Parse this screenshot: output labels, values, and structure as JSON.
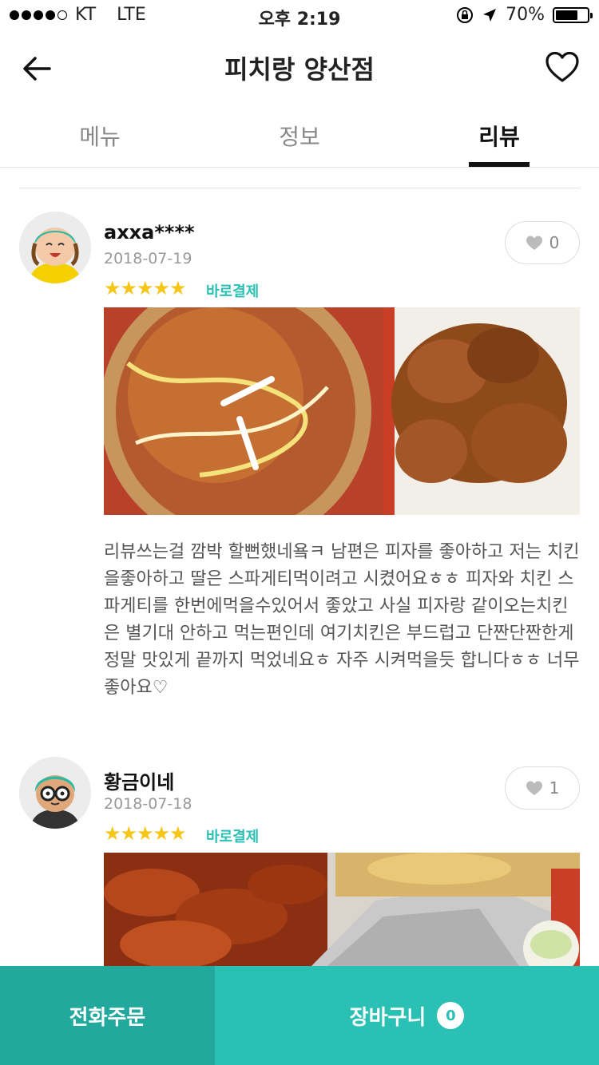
{
  "status_bar": {
    "carrier": "KT",
    "network": "LTE",
    "time": "오후 2:19",
    "battery": "70%",
    "battery_level": 0.7
  },
  "nav": {
    "title": "피치랑 양산점",
    "back_icon": "arrow-left-icon",
    "favorite_icon": "heart-outline-icon"
  },
  "tabs": [
    {
      "label": "메뉴"
    },
    {
      "label": "정보"
    },
    {
      "label": "리뷰",
      "active": true
    }
  ],
  "reviews": [
    {
      "username": "axxa****",
      "date": "2018-07-19",
      "stars": "★★★★★",
      "rating": 5,
      "pay_tag": "바로결제",
      "likes": "0",
      "text": "리뷰쓰는걸 깜박 할뻔했네욬ㅋ 남편은 피자를 좋아하고 저는 치킨을좋아하고 딸은 스파게티먹이려고 시켰어요ㅎㅎ 피자와 치킨 스파게티를 한번에먹을수있어서 좋았고 사실 피자랑 같이오는치킨은 별기대 안하고 먹는편인데 여기치킨은 부드럽고 단짠단짠한게 정말 맛있게 끝까지 먹었네요ㅎ 자주 시켜먹을듯 합니다ㅎㅎ 너무좋아요♡"
    },
    {
      "username": "황금이네",
      "date": "2018-07-18",
      "stars": "★★★★★",
      "rating": 5,
      "pay_tag": "바로결제",
      "likes": "1"
    }
  ],
  "bottom": {
    "phone_order": "전화주문",
    "cart": "장바구니",
    "cart_count": "0"
  },
  "colors": {
    "accent": "#2bc0b4",
    "accent_dark": "#22a89d",
    "star": "#f5c518"
  }
}
